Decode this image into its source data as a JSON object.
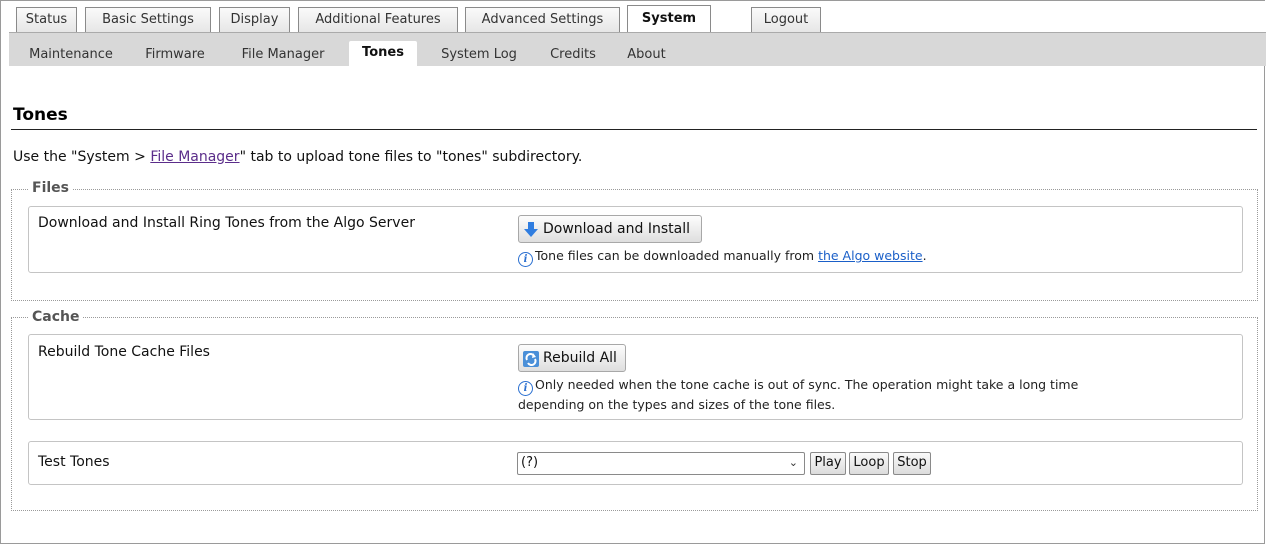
{
  "top_tabs": [
    {
      "label": "Status"
    },
    {
      "label": "Basic Settings"
    },
    {
      "label": "Display"
    },
    {
      "label": "Additional Features"
    },
    {
      "label": "Advanced Settings"
    },
    {
      "label": "System",
      "active": true
    },
    {
      "label": "Logout"
    }
  ],
  "sub_tabs": [
    {
      "label": "Maintenance"
    },
    {
      "label": "Firmware"
    },
    {
      "label": "File Manager"
    },
    {
      "label": "Tones",
      "active": true
    },
    {
      "label": "System Log"
    },
    {
      "label": "Credits"
    },
    {
      "label": "About"
    }
  ],
  "page": {
    "title": "Tones",
    "intro_prefix": "Use the \"System > ",
    "intro_link": "File Manager",
    "intro_suffix": "\" tab to upload tone files to \"tones\" subdirectory."
  },
  "files": {
    "legend": "Files",
    "row_label": "Download and Install Ring Tones from the Algo Server",
    "button_label": "Download and Install",
    "button_icon": "download-arrow-icon",
    "info_prefix": "Tone files can be downloaded manually from ",
    "info_link": "the Algo website",
    "info_suffix": "."
  },
  "cache": {
    "legend": "Cache",
    "rebuild_label": "Rebuild Tone Cache Files",
    "rebuild_button": "Rebuild All",
    "rebuild_icon": "refresh-icon",
    "rebuild_info_line1": "Only needed when the tone cache is out of sync. The operation might take a long time",
    "rebuild_info_line2": "depending on the types and sizes of the tone files.",
    "test_label": "Test Tones",
    "select_value": "(?)",
    "play_label": "Play",
    "loop_label": "Loop",
    "stop_label": "Stop"
  },
  "colors": {
    "accent_link": "#5b2d8a",
    "info_blue": "#2a6fd0"
  }
}
